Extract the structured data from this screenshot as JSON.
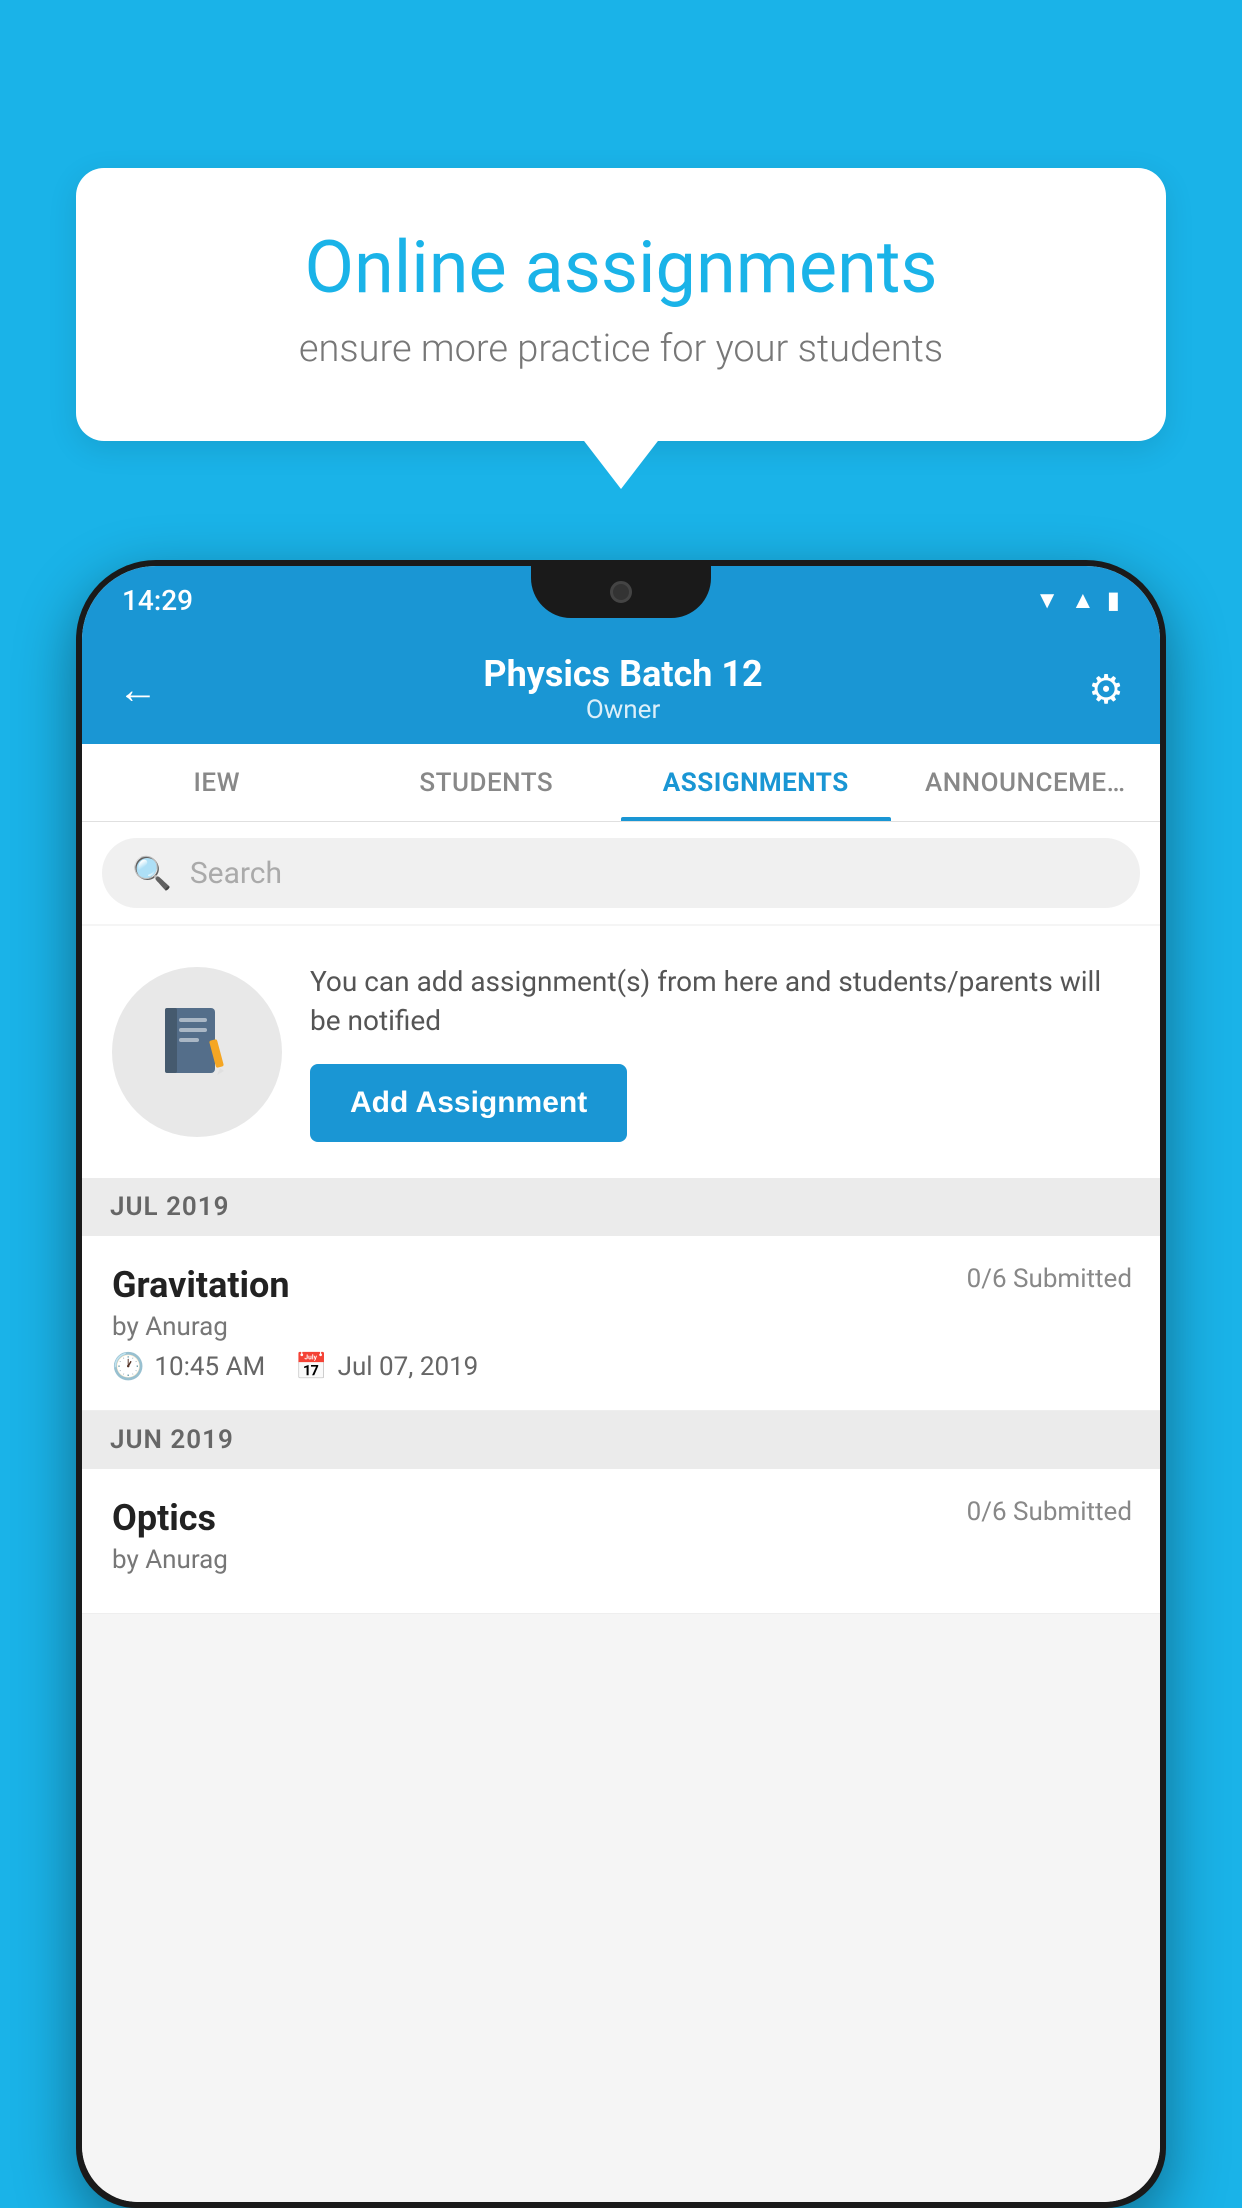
{
  "background_color": "#1ab3e8",
  "bubble": {
    "title": "Online assignments",
    "subtitle": "ensure more practice for your students"
  },
  "status_bar": {
    "time": "14:29",
    "icons": [
      "wifi",
      "signal",
      "battery"
    ]
  },
  "header": {
    "batch_name": "Physics Batch 12",
    "owner_label": "Owner",
    "back_label": "←",
    "settings_label": "⚙"
  },
  "tabs": [
    {
      "label": "IEW",
      "active": false
    },
    {
      "label": "STUDENTS",
      "active": false
    },
    {
      "label": "ASSIGNMENTS",
      "active": true
    },
    {
      "label": "ANNOUNCEMENTS",
      "active": false
    }
  ],
  "search": {
    "placeholder": "Search",
    "icon": "🔍"
  },
  "promo": {
    "description": "You can add assignment(s) from here and students/parents will be notified",
    "button_label": "Add Assignment",
    "icon": "📓"
  },
  "months": [
    {
      "label": "JUL 2019",
      "assignments": [
        {
          "name": "Gravitation",
          "submitted": "0/6 Submitted",
          "author": "by Anurag",
          "time": "10:45 AM",
          "date": "Jul 07, 2019"
        }
      ]
    },
    {
      "label": "JUN 2019",
      "assignments": [
        {
          "name": "Optics",
          "submitted": "0/6 Submitted",
          "author": "by Anurag",
          "time": "",
          "date": ""
        }
      ]
    }
  ]
}
